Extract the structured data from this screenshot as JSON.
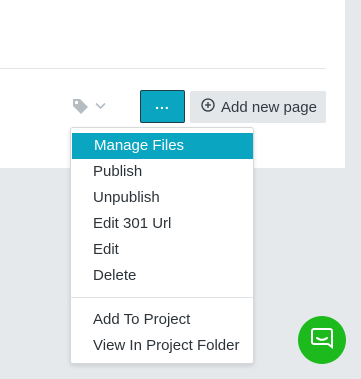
{
  "toolbar": {
    "tag_icon": "tag-icon",
    "chevron_icon": "chevron-down-icon",
    "more_label": "...",
    "add_icon": "plus-circle-icon",
    "add_page_label": "Add new page"
  },
  "menu": {
    "items": [
      {
        "label": "Manage Files",
        "active": true
      },
      {
        "label": "Publish"
      },
      {
        "label": "Unpublish"
      },
      {
        "label": "Edit 301 Url"
      },
      {
        "label": "Edit"
      },
      {
        "label": "Delete"
      }
    ],
    "secondary_items": [
      {
        "label": "Add To Project"
      },
      {
        "label": "View In Project Folder"
      }
    ]
  },
  "chat": {
    "icon": "chat-bubble-icon"
  },
  "colors": {
    "accent": "#0aa5c1",
    "chat": "#1cba1c",
    "background": "#e6e9ec"
  }
}
